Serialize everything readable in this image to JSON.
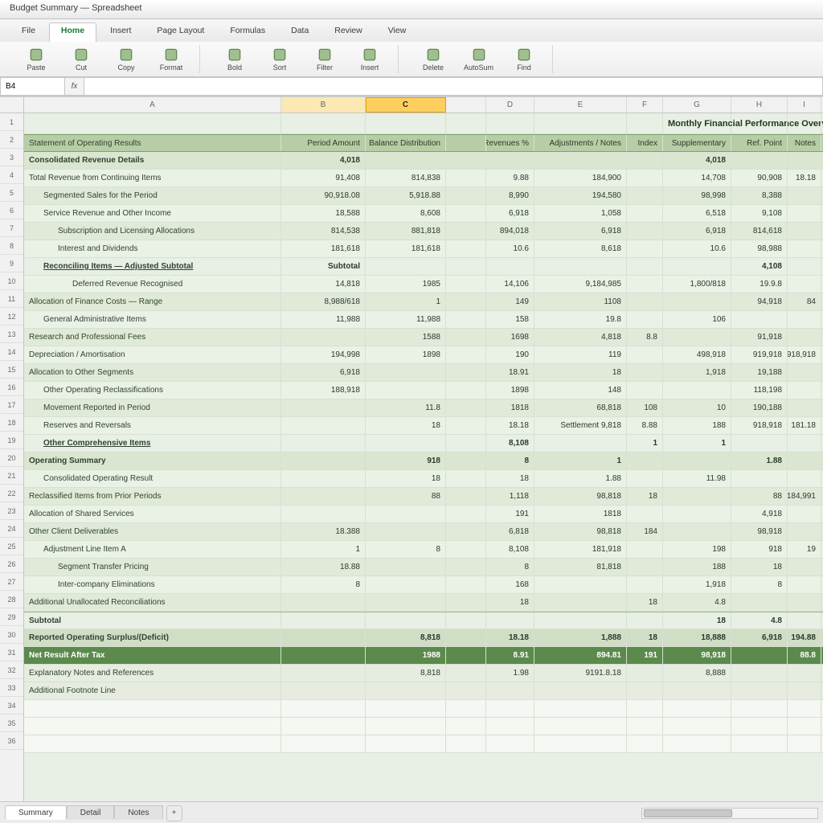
{
  "app": {
    "title": "Budget Summary — Spreadsheet"
  },
  "ribbon": {
    "tabs": [
      "File",
      "Home",
      "Insert",
      "Page Layout",
      "Formulas",
      "Data",
      "Review",
      "View"
    ],
    "active": 1,
    "buttons": [
      "Paste",
      "Cut",
      "Copy",
      "Format",
      "Bold",
      "Sort",
      "Filter",
      "Insert",
      "Delete",
      "AutoSum",
      "Find"
    ]
  },
  "formula": {
    "namebox": "B4",
    "fx": "fx",
    "value": ""
  },
  "columns": [
    {
      "key": "rowhdr",
      "label": "",
      "w": "rowhdr"
    },
    {
      "key": "A",
      "label": "A",
      "w": "w-a"
    },
    {
      "key": "B",
      "label": "B",
      "w": "w-b",
      "sel": "soft"
    },
    {
      "key": "C",
      "label": "C",
      "w": "w-c",
      "sel": "sel"
    },
    {
      "key": "GAP",
      "label": "",
      "w": "w-gap"
    },
    {
      "key": "D",
      "label": "D",
      "w": "w-d"
    },
    {
      "key": "E",
      "label": "E",
      "w": "w-e"
    },
    {
      "key": "F",
      "label": "F",
      "w": "w-f"
    },
    {
      "key": "G",
      "label": "G",
      "w": "w-g"
    },
    {
      "key": "H",
      "label": "H",
      "w": "w-h"
    },
    {
      "key": "I",
      "label": "I",
      "w": "w-i"
    }
  ],
  "sheet": {
    "title_right": "Monthly Financial Performance Overview",
    "header_cells": {
      "A": "Statement of Operating Results",
      "B": "Period Amount",
      "C": "Balance Distribution",
      "D": "Revenues %",
      "E": "Adjustments / Notes",
      "F": "Index",
      "G": "Supplementary",
      "H": "Ref. Point",
      "I": "Notes"
    },
    "rows": [
      {
        "kind": "sub",
        "ind": 0,
        "A": "Consolidated Revenue Details",
        "B": "4,018",
        "C": "",
        "D": "",
        "E": "",
        "F": "",
        "G": "4,018",
        "H": "",
        "I": ""
      },
      {
        "kind": "band-a",
        "ind": 0,
        "A": "Total Revenue from Continuing Items",
        "B": "91,408",
        "C": "814,838",
        "D": "9.88",
        "E": "184,900",
        "F": "",
        "G": "14,708",
        "H": "90,908",
        "I": "18.18"
      },
      {
        "kind": "band-b",
        "ind": 1,
        "A": "Segmented Sales for the Period",
        "B": "90,918.08",
        "C": "5,918.88",
        "D": "8,990",
        "E": "194,580",
        "F": "",
        "G": "98,998",
        "H": "8,388",
        "I": ""
      },
      {
        "kind": "band-a",
        "ind": 1,
        "A": "Service Revenue and Other Income",
        "B": "18,588",
        "C": "8,608",
        "D": "6,918",
        "E": "1,058",
        "F": "",
        "G": "6,518",
        "H": "9,108",
        "I": ""
      },
      {
        "kind": "band-b",
        "ind": 2,
        "A": "Subscription and Licensing Allocations",
        "B": "814,538",
        "C": "881,818",
        "D": "894,018",
        "E": "6,918",
        "F": "",
        "G": "6,918",
        "H": "814,618",
        "I": ""
      },
      {
        "kind": "band-a",
        "ind": 2,
        "A": "Interest and Dividends",
        "B": "181,618",
        "C": "181,618",
        "D": "10.6",
        "E": "8,618",
        "F": "",
        "G": "10.6",
        "H": "98,988",
        "I": ""
      },
      {
        "kind": "section",
        "ind": 1,
        "A": "Reconciling Items — Adjusted Subtotal",
        "B": "Subtotal",
        "C": "",
        "D": "",
        "E": "",
        "F": "",
        "G": "",
        "H": "4,108",
        "I": ""
      },
      {
        "kind": "band-a",
        "ind": 3,
        "A": "Deferred Revenue Recognised",
        "B": "14,818",
        "C": "1985",
        "D": "14,106",
        "E": "9,184,985",
        "F": "",
        "G": "1,800/818",
        "H": "19.9.8",
        "I": ""
      },
      {
        "kind": "band-b",
        "ind": 0,
        "A": "Allocation of Finance Costs — Range",
        "B": "8,988/618",
        "C": "1",
        "D": "149",
        "E": "1108",
        "F": "",
        "G": "",
        "H": "94,918",
        "I": "84"
      },
      {
        "kind": "band-a",
        "ind": 1,
        "A": "General Administrative Items",
        "B": "11,988",
        "C": "11,988",
        "D": "158",
        "E": "19.8",
        "F": "",
        "G": "106",
        "H": "",
        "I": ""
      },
      {
        "kind": "band-b",
        "ind": 0,
        "A": "Research and Professional Fees",
        "B": "",
        "C": "1588",
        "D": "1698",
        "E": "4,818",
        "F": "8.8",
        "G": "",
        "H": "91,918",
        "I": ""
      },
      {
        "kind": "band-a",
        "ind": 0,
        "A": "Depreciation / Amortisation",
        "B": "194,998",
        "C": "1898",
        "D": "190",
        "E": "119",
        "F": "",
        "G": "498,918",
        "H": "919,918",
        "I": "918,918"
      },
      {
        "kind": "band-b",
        "ind": 0,
        "A": "Allocation to Other Segments",
        "B": "6,918",
        "C": "",
        "D": "18.91",
        "E": "18",
        "F": "",
        "G": "1,918",
        "H": "19,188",
        "I": ""
      },
      {
        "kind": "band-a",
        "ind": 1,
        "A": "Other Operating Reclassifications",
        "B": "188,918",
        "C": "",
        "D": "1898",
        "E": "148",
        "F": "",
        "G": "",
        "H": "118,198",
        "I": ""
      },
      {
        "kind": "band-b",
        "ind": 1,
        "A": "Movement Reported in Period",
        "B": "",
        "C": "11.8",
        "D": "1818",
        "E": "68,818",
        "F": "108",
        "G": "10",
        "H": "190,188",
        "I": ""
      },
      {
        "kind": "band-a",
        "ind": 1,
        "A": "Reserves and Reversals",
        "B": "",
        "C": "18",
        "D": "18.18",
        "E": "Settlement 9,818",
        "F": "8.88",
        "G": "188",
        "H": "918,918",
        "I": "181.18"
      },
      {
        "kind": "section",
        "ind": 1,
        "A": "Other Comprehensive Items",
        "B": "",
        "C": "",
        "D": "8,108",
        "E": "",
        "F": "1",
        "G": "1",
        "H": "",
        "I": ""
      },
      {
        "kind": "sub",
        "ind": 0,
        "A": "Operating Summary",
        "B": "",
        "C": "918",
        "D": "8",
        "E": "1",
        "F": "",
        "G": "",
        "H": "1.88",
        "I": ""
      },
      {
        "kind": "band-a",
        "ind": 1,
        "A": "Consolidated Operating Result",
        "B": "",
        "C": "18",
        "D": "18",
        "E": "1.88",
        "F": "",
        "G": "11.98",
        "H": "",
        "I": ""
      },
      {
        "kind": "band-b",
        "ind": 0,
        "A": "Reclassified Items from Prior Periods",
        "B": "",
        "C": "88",
        "D": "1,118",
        "E": "98,818",
        "F": "18",
        "G": "",
        "H": "88",
        "I": "184,991"
      },
      {
        "kind": "band-a",
        "ind": 0,
        "A": "Allocation of Shared Services",
        "B": "",
        "C": "",
        "D": "191",
        "E": "1818",
        "F": "",
        "G": "",
        "H": "4,918",
        "I": ""
      },
      {
        "kind": "band-b",
        "ind": 0,
        "A": "Other Client Deliverables",
        "B": "18.388",
        "C": "",
        "D": "6,818",
        "E": "98,818",
        "F": "184",
        "G": "",
        "H": "98,918",
        "I": ""
      },
      {
        "kind": "band-a",
        "ind": 1,
        "A": "Adjustment Line Item A",
        "B": "1",
        "C": "8",
        "D": "8,108",
        "E": "181,918",
        "F": "",
        "G": "198",
        "H": "918",
        "I": "19"
      },
      {
        "kind": "band-b",
        "ind": 2,
        "A": "Segment Transfer Pricing",
        "B": "18.88",
        "C": "",
        "D": "8",
        "E": "81,818",
        "F": "",
        "G": "188",
        "H": "18",
        "I": ""
      },
      {
        "kind": "band-a",
        "ind": 2,
        "A": "Inter-company Eliminations",
        "B": "8",
        "C": "",
        "D": "168",
        "E": "",
        "F": "",
        "G": "1,918",
        "H": "8",
        "I": ""
      },
      {
        "kind": "band-b",
        "ind": 0,
        "A": "Additional Unallocated Reconciliations",
        "B": "",
        "C": "",
        "D": "18",
        "E": "",
        "F": "18",
        "G": "4.8",
        "H": "",
        "I": ""
      },
      {
        "kind": "subtotal",
        "ind": 0,
        "A": "Subtotal",
        "B": "",
        "C": "",
        "D": "",
        "E": "",
        "F": "",
        "G": "18",
        "H": "4.8",
        "I": ""
      },
      {
        "kind": "total",
        "ind": 0,
        "A": "Reported Operating Surplus/(Deficit)",
        "B": "",
        "C": "8,818",
        "D": "18.18",
        "E": "1,888",
        "F": "18",
        "G": "18,888",
        "H": "6,918",
        "I": "194.88"
      },
      {
        "kind": "grand",
        "ind": 0,
        "A": "Net Result After Tax",
        "B": "",
        "C": "1988",
        "D": "8.91",
        "E": "894.81",
        "F": "191",
        "G": "98,918",
        "H": "",
        "I": "88.8"
      },
      {
        "kind": "foot",
        "ind": 0,
        "A": "Explanatory Notes and References",
        "B": "",
        "C": "8,818",
        "D": "1.98",
        "E": "9191.8.18",
        "F": "",
        "G": "8,888",
        "H": "",
        "I": ""
      },
      {
        "kind": "foot",
        "ind": 0,
        "A": "Additional Footnote Line",
        "B": "",
        "C": "",
        "D": "",
        "E": "",
        "F": "",
        "G": "",
        "H": "",
        "I": ""
      }
    ]
  },
  "tabs": {
    "items": [
      "Summary",
      "Detail",
      "Notes"
    ],
    "active": 0,
    "add": "+"
  },
  "rowcount": 36
}
